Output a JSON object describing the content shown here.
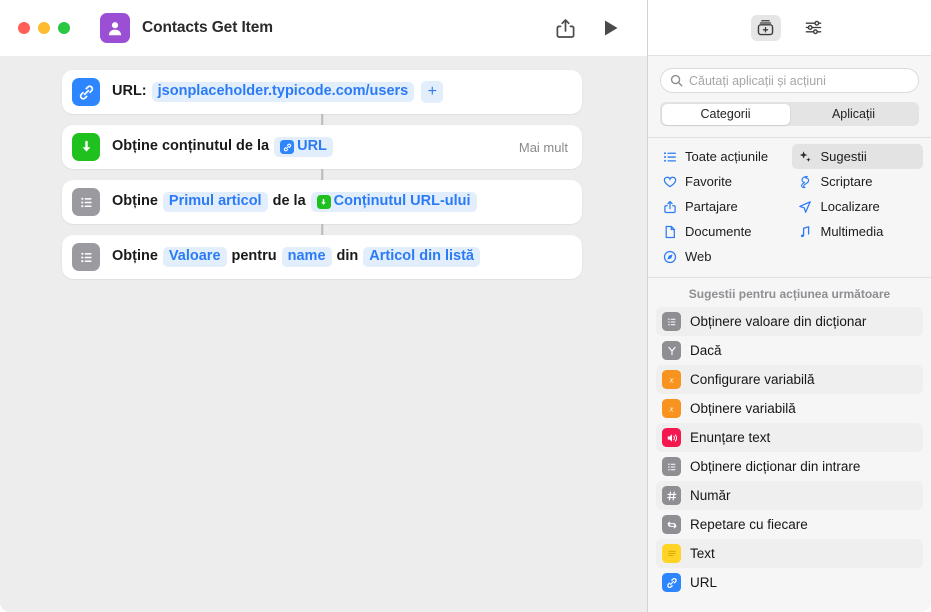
{
  "window": {
    "title": "Contacts Get Item",
    "app_icon": "contacts-icon",
    "traffic_lights": [
      "close",
      "minimize",
      "zoom"
    ],
    "colors": {
      "close": "#ff5f57",
      "minimize": "#febc2e",
      "zoom": "#28c840",
      "app_icon_bg": "#9b4fd4",
      "accent_blue": "#2a7bf5",
      "token_bg": "#e3eefd",
      "green": "#1fc11f",
      "gray_icon": "#8e8e93",
      "orange": "#f7931e",
      "pink": "#f5174f",
      "yellow": "#ffd426"
    },
    "toolbar": {
      "share_label": "share-icon",
      "run_label": "run-icon"
    }
  },
  "workflow": {
    "actions": [
      {
        "icon": "url-link-icon",
        "icon_color": "blue",
        "prefix": "URL:",
        "token": "jsonplaceholder.typicode.com/users",
        "plus": "+"
      },
      {
        "icon": "download-arrow-icon",
        "icon_color": "green",
        "prefix": "Obține conținutul de la",
        "token": "URL",
        "token_icon": "url-link-icon",
        "more": "Mai mult"
      },
      {
        "icon": "list-icon",
        "icon_color": "gray",
        "prefix": "Obține",
        "token1": "Primul articol",
        "middle": "de la",
        "token2": "Conținutul URL-ului",
        "token2_icon": "download-arrow-icon"
      },
      {
        "icon": "list-icon",
        "icon_color": "gray",
        "prefix": "Obține",
        "token1": "Valoare",
        "middle1": "pentru",
        "token2": "name",
        "middle2": "din",
        "token3": "Articol din listă"
      }
    ]
  },
  "sidebar": {
    "toolbar": [
      {
        "name": "action-library-icon",
        "active": true
      },
      {
        "name": "sliders-settings-icon",
        "active": false
      }
    ],
    "search": {
      "placeholder": "Căutați aplicații și acțiuni",
      "value": "",
      "icon": "search-icon"
    },
    "segmented": {
      "selected": "Categorii",
      "options": [
        "Categorii",
        "Aplicații"
      ]
    },
    "categories": [
      {
        "label": "Toate acțiunile",
        "icon": "list-bullet-icon",
        "selected": false
      },
      {
        "label": "Sugestii",
        "icon": "sparkles-icon",
        "selected": true
      },
      {
        "label": "Favorite",
        "icon": "heart-icon",
        "selected": false
      },
      {
        "label": "Scriptare",
        "icon": "scripting-icon",
        "selected": false
      },
      {
        "label": "Partajare",
        "icon": "share-icon",
        "selected": false
      },
      {
        "label": "Localizare",
        "icon": "location-arrow-icon",
        "selected": false
      },
      {
        "label": "Documente",
        "icon": "document-icon",
        "selected": false
      },
      {
        "label": "Multimedia",
        "icon": "music-note-icon",
        "selected": false
      },
      {
        "label": "Web",
        "icon": "compass-icon",
        "selected": false
      }
    ],
    "suggestions": {
      "header": "Sugestii pentru acțiunea următoare",
      "items": [
        {
          "label": "Obținere valoare din dicționar",
          "icon": "list-icon",
          "color": "gray"
        },
        {
          "label": "Dacă",
          "icon": "branch-icon",
          "color": "gray"
        },
        {
          "label": "Configurare variabilă",
          "icon": "variable-icon",
          "color": "orange"
        },
        {
          "label": "Obținere variabilă",
          "icon": "variable-icon",
          "color": "orange"
        },
        {
          "label": "Enunțare text",
          "icon": "speaker-icon",
          "color": "pink"
        },
        {
          "label": "Obținere dicționar din intrare",
          "icon": "list-icon",
          "color": "gray"
        },
        {
          "label": "Număr",
          "icon": "hash-icon",
          "color": "gray"
        },
        {
          "label": "Repetare cu fiecare",
          "icon": "repeat-icon",
          "color": "gray"
        },
        {
          "label": "Text",
          "icon": "text-icon",
          "color": "yellow"
        },
        {
          "label": "URL",
          "icon": "url-link-icon",
          "color": "blue"
        }
      ]
    }
  }
}
